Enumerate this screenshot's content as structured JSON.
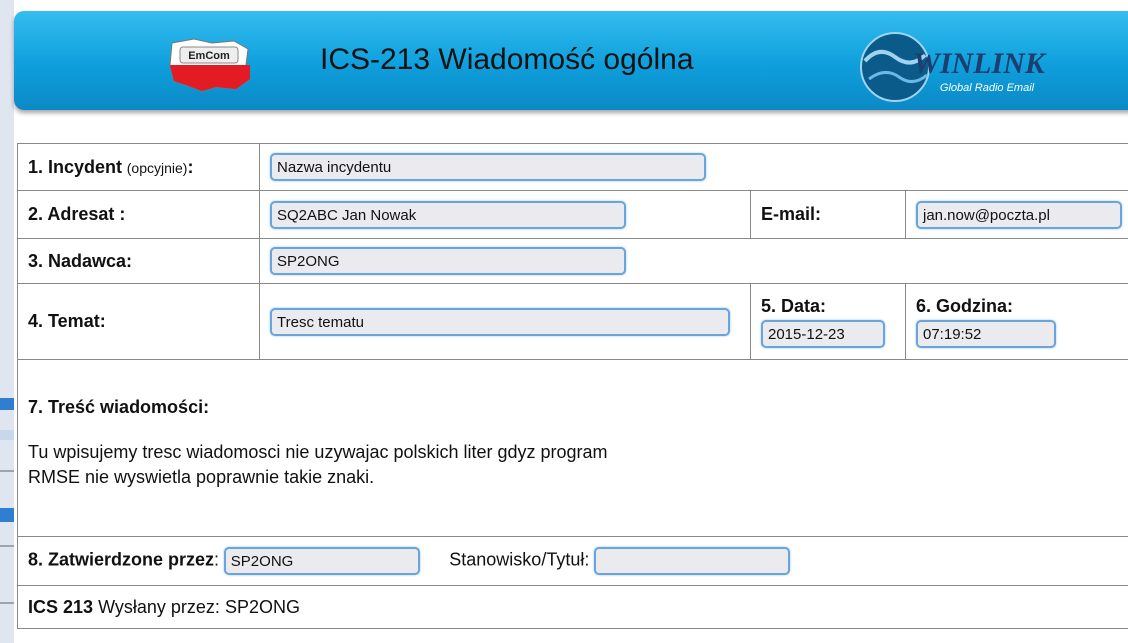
{
  "header": {
    "title": "ICS-213 Wiadomość ogólna",
    "emcom_logo_text": "EmCom",
    "winlink_logo_text": "WINLINK",
    "winlink_tagline": "Global Radio Email"
  },
  "form": {
    "incident": {
      "label": "1. Incydent",
      "label_note": "(opcyjnie)",
      "label_suffix": ":",
      "value": "Nazwa incydentu"
    },
    "to": {
      "label": "2. Adresat :",
      "value": "SQ2ABC Jan Nowak"
    },
    "email": {
      "label": "E-mail:",
      "value": "jan.now@poczta.pl"
    },
    "from": {
      "label": "3. Nadawca:",
      "value": "SP2ONG"
    },
    "subject": {
      "label": "4. Temat:",
      "value": "Tresc tematu"
    },
    "date": {
      "label": "5. Data:",
      "value": "2015-12-23"
    },
    "time": {
      "label": "6. Godzina:",
      "value": "07:19:52"
    },
    "message": {
      "label": "7. Treść wiadomości:",
      "line1": "Tu wpisujemy tresc wiadomosci nie uzywajac polskich liter gdyz program",
      "line2": "RMSE nie wyswietla poprawnie takie znaki."
    },
    "approved": {
      "label": "8. Zatwierdzone przez",
      "label_suffix": ":",
      "value": "SP2ONG",
      "position_label": "Stanowisko/Tytuł:",
      "position_value": ""
    },
    "footer": {
      "form_name": "ICS 213",
      "sent_by_label": "Wysłany przez:",
      "sent_by_value": "SP2ONG"
    }
  },
  "colors": {
    "banner_top": "#34bdf0",
    "banner_bottom": "#0b89c6",
    "field_border": "#6aa4dc",
    "field_bg": "#ebebef"
  }
}
